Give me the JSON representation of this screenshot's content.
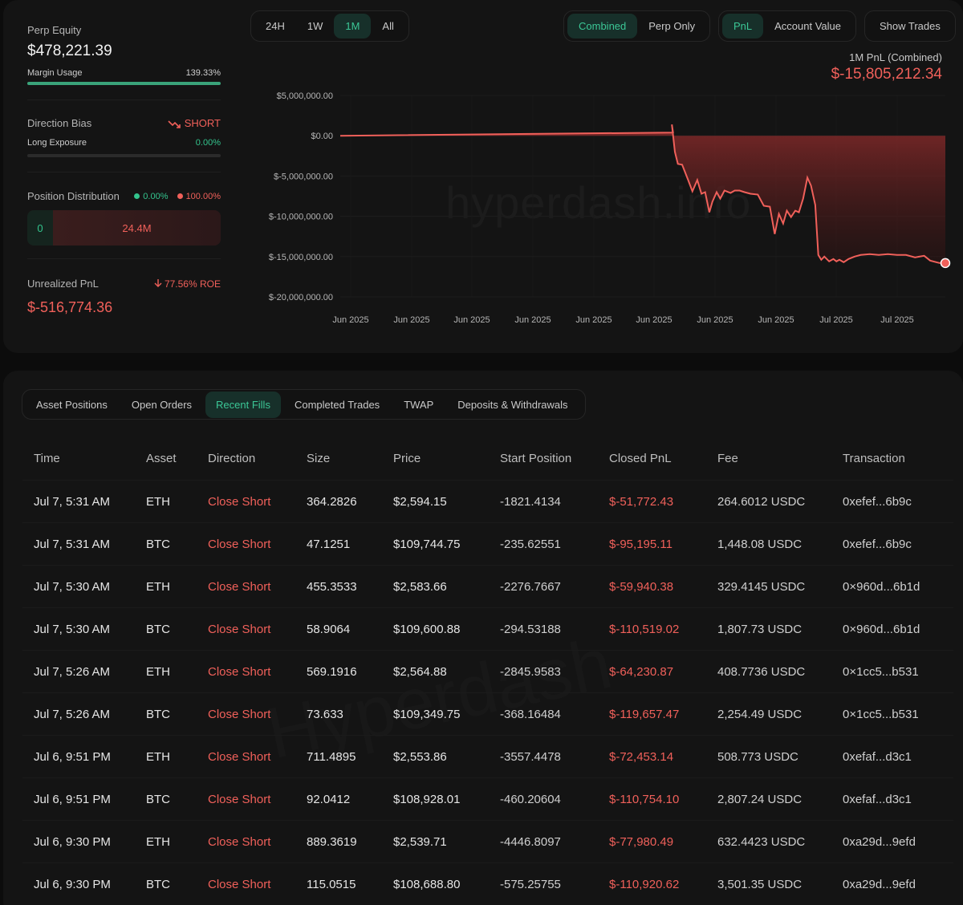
{
  "summary": {
    "perp_equity_label": "Perp Equity",
    "perp_equity_value": "$478,221.39",
    "margin_usage_label": "Margin Usage",
    "margin_usage_value": "139.33%",
    "margin_usage_fill": 1.0,
    "direction_bias_label": "Direction Bias",
    "direction_bias_value": "SHORT",
    "long_exposure_label": "Long Exposure",
    "long_exposure_value": "0.00%",
    "position_distribution_label": "Position Distribution",
    "dist_long_pct": "0.00%",
    "dist_short_pct": "100.00%",
    "dist_long_amount": "0",
    "dist_short_amount": "24.4M",
    "unrealized_pnl_label": "Unrealized PnL",
    "roe_value": "77.56% ROE",
    "unrealized_pnl_value": "$-516,774.36"
  },
  "range_tabs": [
    "24H",
    "1W",
    "1M",
    "All"
  ],
  "range_selected": "1M",
  "mode_tabs": [
    "Combined",
    "Perp Only"
  ],
  "mode_selected": "Combined",
  "metric_tabs": [
    "PnL",
    "Account Value"
  ],
  "metric_selected": "PnL",
  "show_trades_label": "Show Trades",
  "pnl_header": {
    "title": "1M PnL (Combined)",
    "value": "$-15,805,212.34"
  },
  "watermark": "hyperdash.info",
  "colors": {
    "accent_green": "#3bc796",
    "loss_red": "#f0605a",
    "bg": "#0c0c0c",
    "card": "#141414"
  },
  "chart_data": {
    "type": "area",
    "title": "1M PnL (Combined)",
    "ylim": [
      -20000000,
      5000000
    ],
    "y_ticks": [
      "$5,000,000.00",
      "$0.00",
      "$-5,000,000.00",
      "$-10,000,000.00",
      "$-15,000,000.00",
      "$-20,000,000.00"
    ],
    "x_ticks": [
      "Jun 2025",
      "Jun 2025",
      "Jun 2025",
      "Jun 2025",
      "Jun 2025",
      "Jun 2025",
      "Jun 2025",
      "Jun 2025",
      "Jul 2025",
      "Jul 2025"
    ],
    "series": [
      {
        "x": [
          0,
          0.55,
          0.548,
          0.553,
          0.558,
          0.565,
          0.575,
          0.582,
          0.59,
          0.597,
          0.603,
          0.61,
          0.615,
          0.622,
          0.628,
          0.635,
          0.645,
          0.652,
          0.66,
          0.668,
          0.678,
          0.69,
          0.7,
          0.71,
          0.718,
          0.725,
          0.732,
          0.738,
          0.745,
          0.752,
          0.758,
          0.765,
          0.772,
          0.778,
          0.785,
          0.79,
          0.795,
          0.8,
          0.808,
          0.815,
          0.82,
          0.825,
          0.832,
          0.84,
          0.85,
          0.86,
          0.875,
          0.89,
          0.905,
          0.92,
          0.935,
          0.95,
          0.965,
          0.975,
          0.99,
          1.0
        ],
        "values": [
          0,
          400000,
          1400000,
          -2000000,
          -3500000,
          -3600000,
          -5500000,
          -6900000,
          -5500000,
          -7200000,
          -7000000,
          -9500000,
          -8200000,
          -7000000,
          -7800000,
          -6800000,
          -7100000,
          -6800000,
          -6800000,
          -7000000,
          -7200000,
          -7300000,
          -8700000,
          -8800000,
          -12200000,
          -9700000,
          -10900000,
          -9300000,
          -10100000,
          -9300000,
          -9500000,
          -7800000,
          -5200000,
          -6200000,
          -8600000,
          -14800000,
          -15400000,
          -15000000,
          -15600000,
          -15300000,
          -15600000,
          -15400000,
          -15700000,
          -15300000,
          -15000000,
          -14800000,
          -14700000,
          -14800000,
          -14700000,
          -14800000,
          -14800000,
          -15100000,
          -14900000,
          -15500000,
          -15800000,
          -15805212
        ]
      }
    ],
    "grid": true
  },
  "tables": {
    "tabs": [
      "Asset Positions",
      "Open Orders",
      "Recent Fills",
      "Completed Trades",
      "TWAP",
      "Deposits & Withdrawals"
    ],
    "selected_tab": "Recent Fills",
    "headers": [
      "Time",
      "Asset",
      "Direction",
      "Size",
      "Price",
      "Start Position",
      "Closed PnL",
      "Fee",
      "Transaction"
    ],
    "rows": [
      [
        "Jul 7, 5:31 AM",
        "ETH",
        "Close Short",
        "364.2826",
        "$2,594.15",
        "-1821.4134",
        "$-51,772.43",
        "264.6012 USDC",
        "0xefef...6b9c"
      ],
      [
        "Jul 7, 5:31 AM",
        "BTC",
        "Close Short",
        "47.1251",
        "$109,744.75",
        "-235.62551",
        "$-95,195.11",
        "1,448.08 USDC",
        "0xefef...6b9c"
      ],
      [
        "Jul 7, 5:30 AM",
        "ETH",
        "Close Short",
        "455.3533",
        "$2,583.66",
        "-2276.7667",
        "$-59,940.38",
        "329.4145 USDC",
        "0×960d...6b1d"
      ],
      [
        "Jul 7, 5:30 AM",
        "BTC",
        "Close Short",
        "58.9064",
        "$109,600.88",
        "-294.53188",
        "$-110,519.02",
        "1,807.73 USDC",
        "0×960d...6b1d"
      ],
      [
        "Jul 7, 5:26 AM",
        "ETH",
        "Close Short",
        "569.1916",
        "$2,564.88",
        "-2845.9583",
        "$-64,230.87",
        "408.7736 USDC",
        "0×1cc5...b531"
      ],
      [
        "Jul 7, 5:26 AM",
        "BTC",
        "Close Short",
        "73.633",
        "$109,349.75",
        "-368.16484",
        "$-119,657.47",
        "2,254.49 USDC",
        "0×1cc5...b531"
      ],
      [
        "Jul 6, 9:51 PM",
        "ETH",
        "Close Short",
        "711.4895",
        "$2,553.86",
        "-3557.4478",
        "$-72,453.14",
        "508.773 USDC",
        "0xefaf...d3c1"
      ],
      [
        "Jul 6, 9:51 PM",
        "BTC",
        "Close Short",
        "92.0412",
        "$108,928.01",
        "-460.20604",
        "$-110,754.10",
        "2,807.24 USDC",
        "0xefaf...d3c1"
      ],
      [
        "Jul 6, 9:30 PM",
        "ETH",
        "Close Short",
        "889.3619",
        "$2,539.71",
        "-4446.8097",
        "$-77,980.49",
        "632.4423 USDC",
        "0xa29d...9efd"
      ],
      [
        "Jul 6, 9:30 PM",
        "BTC",
        "Close Short",
        "115.0515",
        "$108,688.80",
        "-575.25755",
        "$-110,920.62",
        "3,501.35 USDC",
        "0xa29d...9efd"
      ]
    ]
  }
}
